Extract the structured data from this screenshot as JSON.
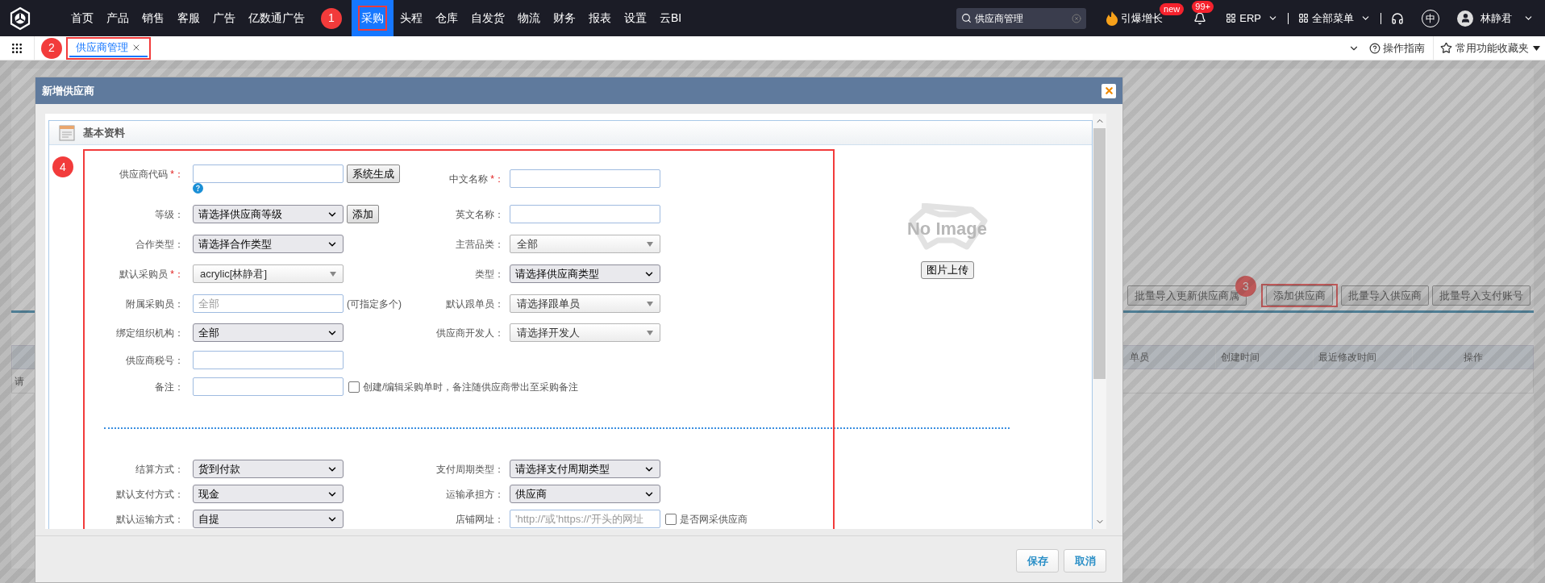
{
  "nav": {
    "annotation": "1",
    "items": [
      {
        "label": "首页",
        "selected": false,
        "outlined": false
      },
      {
        "label": "产品",
        "selected": false,
        "outlined": false
      },
      {
        "label": "销售",
        "selected": false,
        "outlined": false
      },
      {
        "label": "客服",
        "selected": false,
        "outlined": false
      },
      {
        "label": "广告",
        "selected": false,
        "outlined": false
      },
      {
        "label": "亿数通广告",
        "selected": false,
        "outlined": false
      },
      {
        "label": "采购",
        "selected": true,
        "outlined": true
      },
      {
        "label": "头程",
        "selected": false,
        "outlined": false
      },
      {
        "label": "仓库",
        "selected": false,
        "outlined": false
      },
      {
        "label": "自发货",
        "selected": false,
        "outlined": false
      },
      {
        "label": "物流",
        "selected": false,
        "outlined": false
      },
      {
        "label": "财务",
        "selected": false,
        "outlined": false
      },
      {
        "label": "报表",
        "selected": false,
        "outlined": false
      },
      {
        "label": "设置",
        "selected": false,
        "outlined": false
      },
      {
        "label": "云BI",
        "selected": false,
        "outlined": false
      }
    ],
    "search": {
      "value": "供应商管理"
    },
    "promo": {
      "label": "引爆增长",
      "badge": "new"
    },
    "notifications": {
      "badge": "99+"
    },
    "erp": "ERP",
    "all_menu": "全部菜单",
    "language": "中",
    "user": "林静君"
  },
  "tabs": {
    "annotation": "2",
    "items": [
      {
        "label": "供应商管理",
        "selected": true,
        "outlined": true
      }
    ],
    "guide": "操作指南",
    "favorites": "常用功能收藏夹"
  },
  "background": {
    "annotation": "3",
    "buttons": [
      {
        "label": "批量导入更新供应商属",
        "outlined": false
      },
      {
        "label": "添加供应商",
        "outlined": true
      },
      {
        "label": "批量导入供应商",
        "outlined": false
      },
      {
        "label": "批量导入支付账号",
        "outlined": false
      }
    ],
    "columns": [
      "单员",
      "创建时间",
      "最近修改时间",
      "操作"
    ],
    "row_text": "请"
  },
  "dialog": {
    "title": "新增供应商",
    "section": "基本资料",
    "annotation": "4",
    "outlined": true,
    "rows": [
      {
        "left": {
          "label": "供应商代码",
          "required_mark": "*：",
          "kind": "input",
          "button": "系统生成",
          "help": true
        },
        "right": {
          "label": "中文名称",
          "required_mark": "*：",
          "kind": "input"
        }
      },
      {
        "left": {
          "label": "等级：",
          "kind": "select",
          "value": "请选择供应商等级",
          "button": "添加"
        },
        "right": {
          "label": "英文名称：",
          "kind": "input"
        }
      },
      {
        "left": {
          "label": "合作类型：",
          "kind": "select",
          "value": "请选择合作类型"
        },
        "right": {
          "label": "主营品类：",
          "kind": "combo",
          "value": "全部"
        }
      },
      {
        "left": {
          "label": "默认采购员",
          "required_mark": "*：",
          "kind": "combo",
          "value": "acrylic[林静君]"
        },
        "right": {
          "label": "类型：",
          "kind": "select",
          "value": "请选择供应商类型"
        }
      },
      {
        "left": {
          "label": "附属采购员：",
          "kind": "input",
          "placeholder": "全部",
          "note": "(可指定多个)"
        },
        "right": {
          "label": "默认跟单员：",
          "kind": "combo",
          "value": "请选择跟单员"
        }
      },
      {
        "left": {
          "label": "绑定组织机构：",
          "kind": "select",
          "value": "全部"
        },
        "right": {
          "label": "供应商开发人：",
          "kind": "combo",
          "value": "请选择开发人"
        }
      },
      {
        "left": {
          "label": "供应商税号：",
          "kind": "input"
        }
      },
      {
        "left": {
          "label": "备注：",
          "kind": "input",
          "checkbox": {
            "label": "创建/编辑采购单时，备注随供应商带出至采购备注",
            "checked": false
          }
        }
      }
    ],
    "lower_rows": [
      {
        "left": {
          "label": "结算方式：",
          "kind": "select",
          "value": "货到付款"
        },
        "right": {
          "label": "支付周期类型：",
          "kind": "select",
          "value": "请选择支付周期类型"
        }
      },
      {
        "left": {
          "label": "默认支付方式：",
          "kind": "select",
          "value": "现金"
        },
        "right": {
          "label": "运输承担方：",
          "kind": "select",
          "value": "供应商"
        }
      },
      {
        "left": {
          "label": "默认运输方式：",
          "kind": "select",
          "value": "自提"
        },
        "right": {
          "label": "店铺网址：",
          "kind": "input",
          "placeholder": "'http://'或'https://'开头的网址",
          "checkbox": {
            "label": "是否网采供应商",
            "checked": false
          }
        }
      }
    ],
    "image_text": "No Image",
    "upload": "图片上传",
    "buttons": [
      "保存",
      "取消"
    ]
  }
}
